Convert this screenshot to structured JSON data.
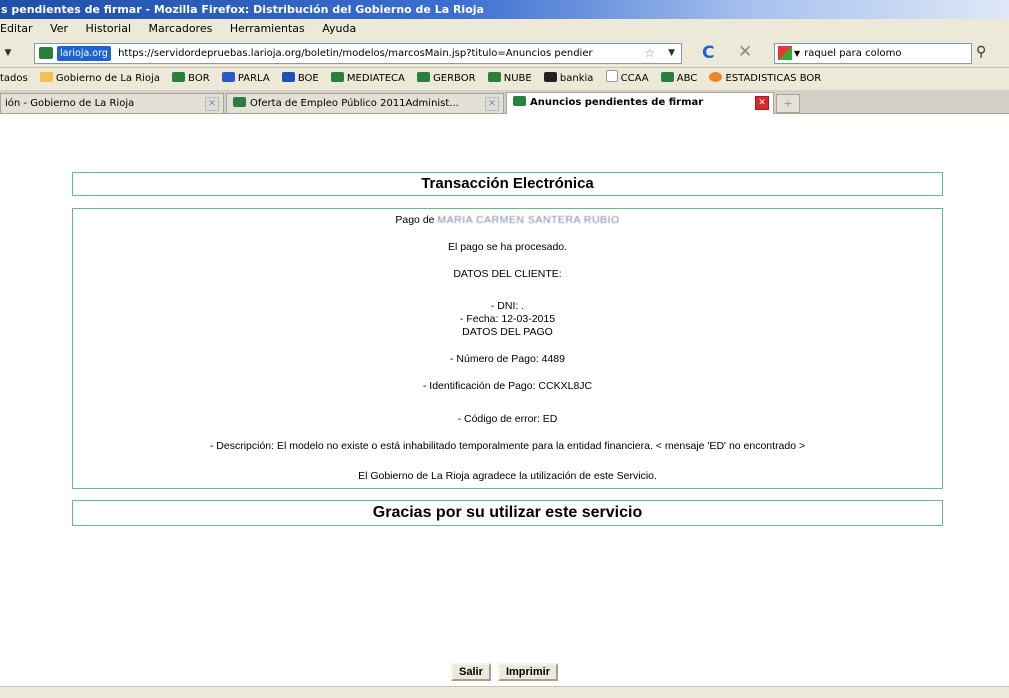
{
  "window": {
    "title": "s pendientes de firmar - Mozilla Firefox: Distribución del Gobierno de La Rioja"
  },
  "menu": [
    "Editar",
    "Ver",
    "Historial",
    "Marcadores",
    "Herramientas",
    "Ayuda"
  ],
  "nav": {
    "site_identity": "larioja.org",
    "url": "https://servidordepruebas.larioja.org/boletin/modelos/marcosMain.jsp?titulo=Anuncios pendier",
    "search_value": "raquel para colomo"
  },
  "bookmarks": [
    {
      "label": "tados",
      "icon": "folder-icon"
    },
    {
      "label": "Gobierno de La Rioja",
      "icon": "folder-icon"
    },
    {
      "label": "BOR",
      "icon": "site-icon"
    },
    {
      "label": "PARLA",
      "icon": "site-icon"
    },
    {
      "label": "BOE",
      "icon": "site-icon"
    },
    {
      "label": "MEDIATECA",
      "icon": "site-icon"
    },
    {
      "label": "GERBOR",
      "icon": "site-icon"
    },
    {
      "label": "NUBE",
      "icon": "site-icon"
    },
    {
      "label": "bankia",
      "icon": "bankia-icon"
    },
    {
      "label": "CCAA",
      "icon": "page-icon"
    },
    {
      "label": "ABC",
      "icon": "site-icon"
    },
    {
      "label": "ESTADISTICAS BOR",
      "icon": "globe-icon"
    }
  ],
  "tabs": [
    {
      "label": "ión - Gobierno de La Rioja"
    },
    {
      "label": "Oferta de Empleo Público 2011Administ..."
    },
    {
      "label": "Anuncios pendientes de firmar"
    }
  ],
  "content": {
    "title": "Transacción Electrónica",
    "pago_de": "Pago de",
    "pago_name_redacted": "MARIA CARMEN SANTERA RUBIO",
    "procesado": "El pago se ha procesado.",
    "datos_cliente": "DATOS DEL CLIENTE:",
    "dni": "- DNI: .",
    "fecha": "- Fecha: 12-03-2015",
    "datos_pago": "DATOS DEL PAGO",
    "numero_pago": "- Número de Pago: 4489",
    "identificacion": "- Identificación de Pago: CCKXL8JC",
    "codigo_error": "- Código de error: ED",
    "descripcion": "- Descripción: El modelo no existe o está inhabilitado temporalmente para la entidad financiera. < mensaje 'ED' no encontrado >",
    "agradece": "El Gobierno de La Rioja agradece la utilización de este Servicio.",
    "footer": "Gracias por su utilizar este servicio"
  },
  "buttons": {
    "salir": "Salir",
    "imprimir": "Imprimir"
  }
}
